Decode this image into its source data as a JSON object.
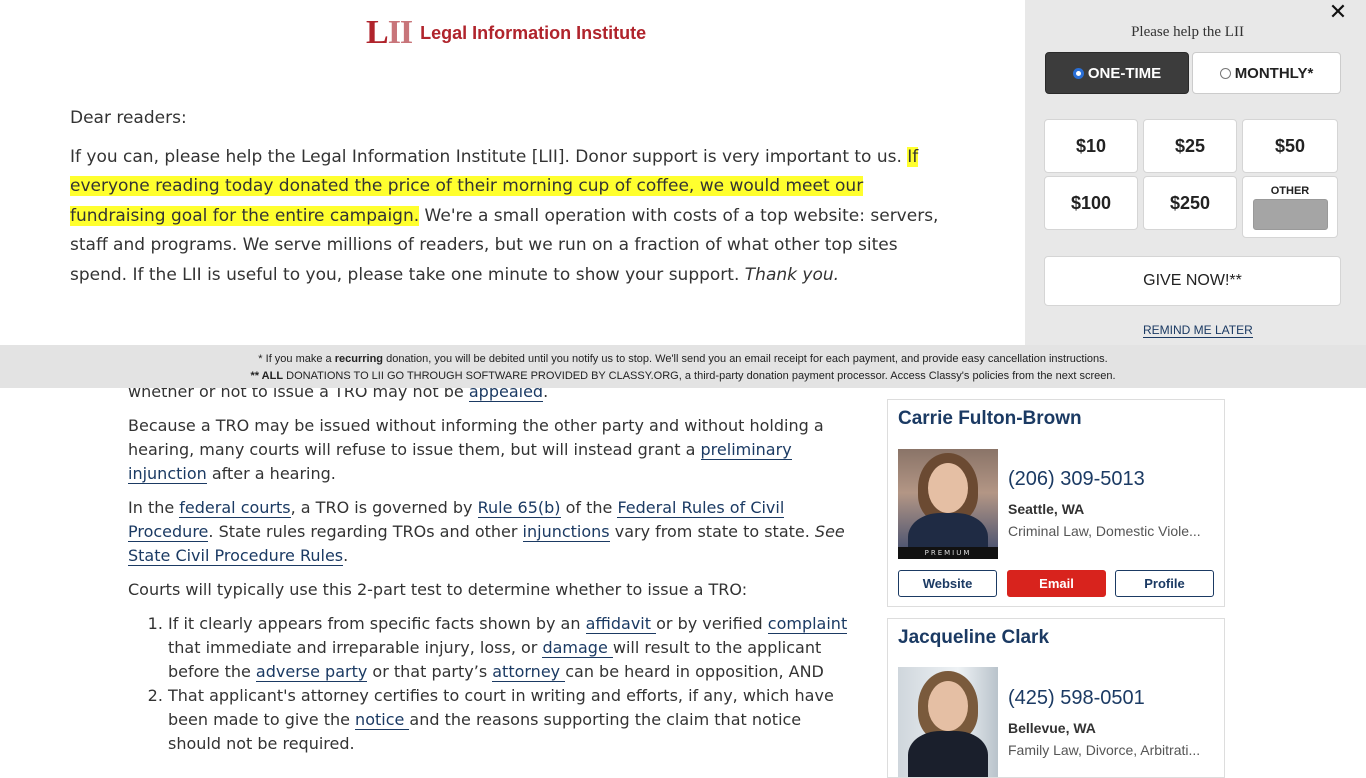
{
  "logo": {
    "mark_a": "L",
    "mark_b": "II",
    "text": "Legal Information Institute"
  },
  "letter": {
    "greeting": "Dear readers:",
    "p1_a": "If you can, please help the Legal Information Institute [LII]. Donor support is very important to us. ",
    "p1_highlight": "If everyone reading today donated the price of their morning cup of coffee, we would meet our fundraising goal for the entire campaign.",
    "p1_b": " We're a small operation with costs of a top website: servers, staff and programs. We serve millions of readers, but we run on a fraction of what other top sites spend. If the LII is useful to you, please take one minute to show your support. ",
    "p1_thanks": "Thank you."
  },
  "donate": {
    "title": "Please help the LII",
    "close": "✕",
    "one_time": "ONE-TIME",
    "monthly": "MONTHLY*",
    "amounts": [
      "$10",
      "$25",
      "$50",
      "$100",
      "$250"
    ],
    "other_label": "OTHER",
    "give": "GIVE NOW!**",
    "remind": "REMIND ME LATER"
  },
  "footnote": {
    "l1_a": "* If you make a ",
    "l1_bold": "recurring",
    "l1_b": " donation, you will be debited until you notify us to stop. We'll send you an email receipt for each payment, and provide easy cancellation instructions.",
    "l2_bold": "** ALL",
    "l2_b": " DONATIONS TO LII GO THROUGH SOFTWARE PROVIDED BY CLASSY.ORG, a third-party donation payment processor. Access Classy's policies from the next screen."
  },
  "article": {
    "p0_a": "whether or not to issue a TRO may not be ",
    "p0_link": "appealed",
    "p0_b": ".",
    "p1_a": "Because a TRO may be issued without informing the other party and without holding a hearing, many courts will refuse to issue them, but will instead grant a ",
    "p1_link": "preliminary injunction",
    "p1_b": " after a hearing.",
    "p2_a": "In the ",
    "p2_link1": "federal courts",
    "p2_b": ", a TRO is governed by ",
    "p2_link2": "Rule 65(b)",
    "p2_c": " of the ",
    "p2_link3": "Federal Rules of Civil Procedure",
    "p2_d": ". State rules regarding TROs and other ",
    "p2_link4": "injunctions",
    "p2_e": " vary from state to state. ",
    "p2_see": "See",
    "p2_f": " ",
    "p2_link5": "State Civil Procedure Rules",
    "p2_g": ".",
    "p3": "Courts will typically use this 2-part test to determine whether to issue a TRO:",
    "li1_a": "If it clearly appears from specific facts shown by an ",
    "li1_link1": "affidavit ",
    "li1_b": "or by verified ",
    "li1_link2": "complaint ",
    "li1_c": "that immediate and irreparable injury, loss, or ",
    "li1_link3": "damage ",
    "li1_d": "will result to the applicant before the ",
    "li1_link4": "adverse party",
    "li1_e": " or that party’s ",
    "li1_link5": "attorney ",
    "li1_f": "can be heard in opposition, AND",
    "li2_a": "That applicant's attorney certifies to court in writing and efforts, if any, which have been made to give the ",
    "li2_link": "notice ",
    "li2_b": "and the reasons supporting the claim that notice should not be required."
  },
  "lawyers": [
    {
      "name": "Carrie Fulton-Brown",
      "phone": "(206) 309-5013",
      "city": "Seattle, WA",
      "areas": "Criminal Law, Domestic Viole...",
      "badge": "PREMIUM",
      "website": "Website",
      "email": "Email",
      "profile": "Profile"
    },
    {
      "name": "Jacqueline Clark",
      "phone": "(425) 598-0501",
      "city": "Bellevue, WA",
      "areas": "Family Law, Divorce, Arbitrati..."
    }
  ]
}
